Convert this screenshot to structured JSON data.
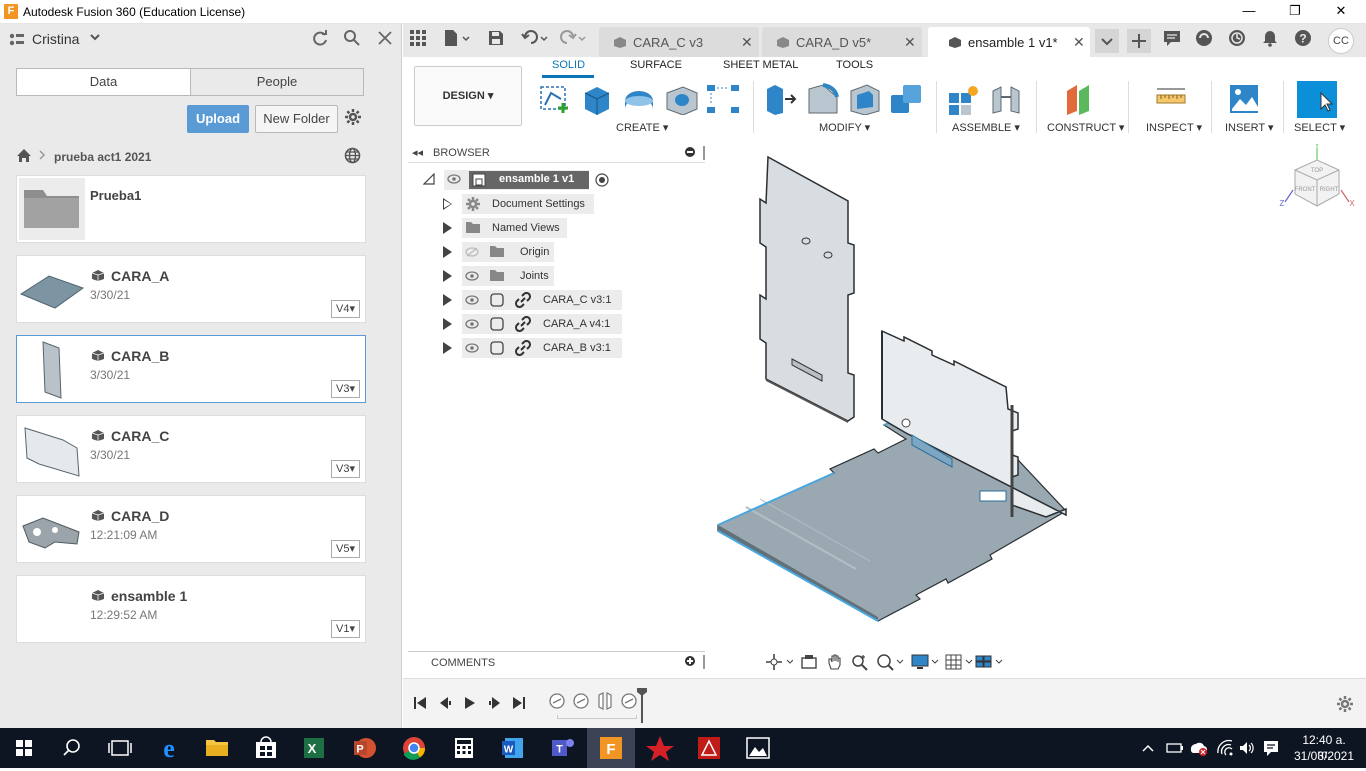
{
  "window": {
    "title": "Autodesk Fusion 360 (Education License)",
    "logo": "F",
    "minimize": "—",
    "restore": "❐",
    "close": "✕"
  },
  "left_panel": {
    "user": "Cristina",
    "tabs": [
      "Data",
      "People"
    ],
    "upload_label": "Upload",
    "new_folder_label": "New Folder",
    "breadcrumb": "prueba act1 2021",
    "folder": {
      "name": "Prueba1"
    },
    "items": [
      {
        "name": "CARA_A",
        "date": "3/30/21",
        "version": "V4"
      },
      {
        "name": "CARA_B",
        "date": "3/30/21",
        "version": "V3"
      },
      {
        "name": "CARA_C",
        "date": "3/30/21",
        "version": "V3"
      },
      {
        "name": "CARA_D",
        "date": "12:21:09 AM",
        "version": "V5"
      },
      {
        "name": "ensamble 1",
        "date": "12:29:52 AM",
        "version": "V1"
      }
    ]
  },
  "doc_tabs": [
    {
      "label": "CARA_C v3",
      "close": "✕"
    },
    {
      "label": "CARA_D v5*",
      "close": "✕"
    },
    {
      "label": "ensamble 1 v1*",
      "close": "✕"
    }
  ],
  "toolbar": {
    "design_label": "DESIGN ▾",
    "workspace_tabs": [
      "SOLID",
      "SURFACE",
      "SHEET METAL",
      "TOOLS"
    ],
    "groups": [
      "CREATE ▾",
      "MODIFY ▾",
      "ASSEMBLE ▾",
      "CONSTRUCT ▾",
      "INSPECT ▾",
      "INSERT ▾",
      "SELECT ▾"
    ]
  },
  "browser": {
    "title": "BROWSER",
    "root": "ensamble 1 v1",
    "nodes": [
      "Document Settings",
      "Named Views",
      "Origin",
      "Joints",
      "CARA_C v3:1",
      "CARA_A v4:1",
      "CARA_B v3:1"
    ]
  },
  "comments_label": "COMMENTS",
  "viewcube": {
    "top": "TOP",
    "front": "FRONT",
    "right": "RIGHT",
    "x": "X",
    "y": "Y",
    "z": "Z"
  },
  "clock": {
    "time": "12:40 a. m.",
    "date": "31/03/2021"
  },
  "colors": {
    "accent": "#0a76b8",
    "upload": "#5a9bd5",
    "fusion_orange": "#f29522",
    "taskbar": "#0d1422"
  }
}
